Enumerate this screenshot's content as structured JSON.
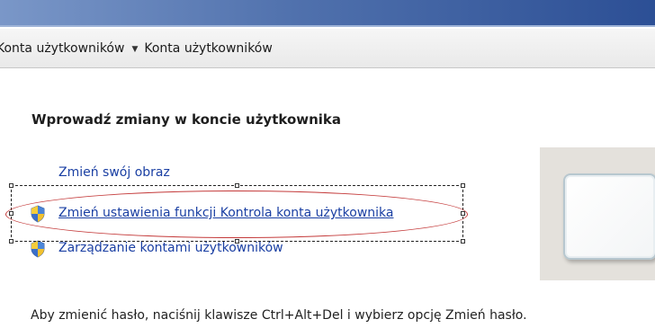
{
  "breadcrumb": {
    "items": [
      "Konta użytkowników",
      "Konta użytkowników"
    ]
  },
  "main": {
    "heading": "Wprowadź zmiany w koncie użytkownika",
    "links": [
      {
        "label": "Zmień swój obraz",
        "icon": "none"
      },
      {
        "label": "Zmień ustawienia funkcji Kontrola konta użytkownika",
        "icon": "uac-shield-icon"
      },
      {
        "label": "Zarządzanie kontami użytkowników",
        "icon": "uac-shield-icon"
      }
    ],
    "footer": "Aby zmienić hasło, naciśnij klawisze Ctrl+Alt+Del i wybierz opcję Zmień hasło."
  },
  "colors": {
    "link": "#1a3fa3",
    "highlight_ellipse": "#c43a3a",
    "title_bar": "#2c4f95"
  }
}
